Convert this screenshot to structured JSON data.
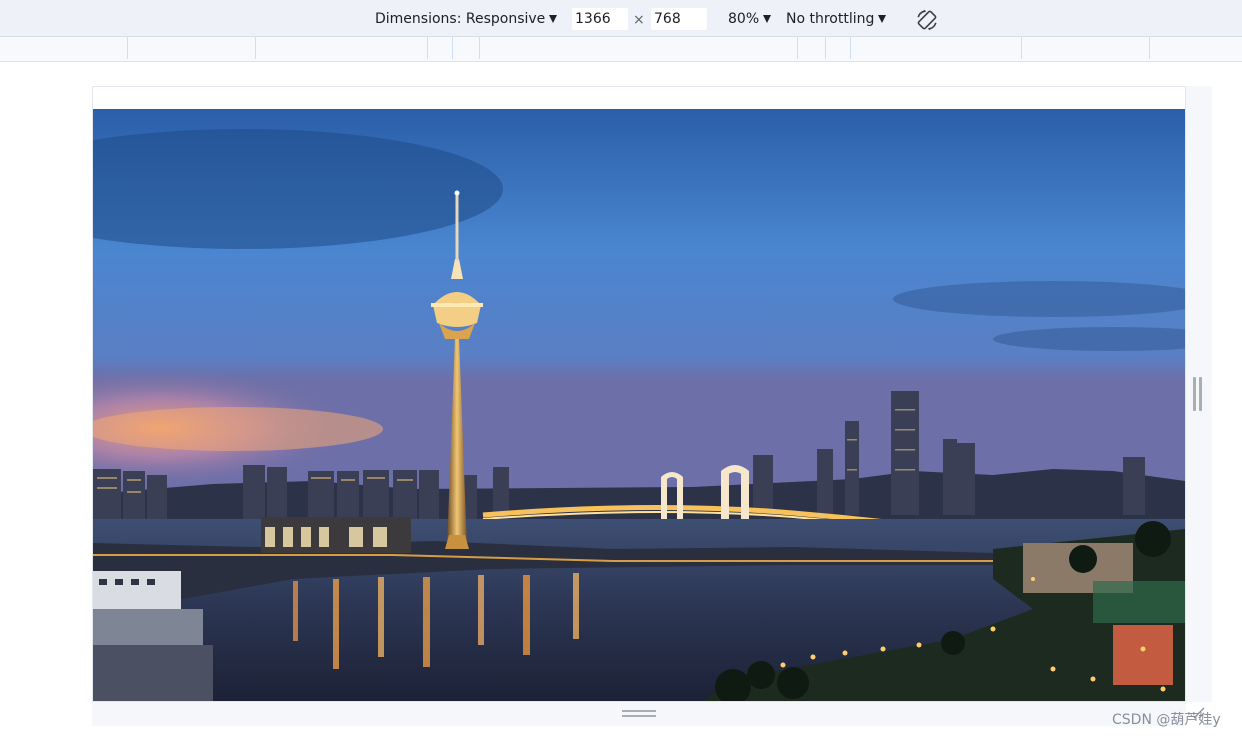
{
  "toolbar": {
    "dimensions_label": "Dimensions: Responsive",
    "width_value": "1366",
    "times_symbol": "×",
    "height_value": "768",
    "zoom_label": "80%",
    "throttling_label": "No throttling",
    "dropdown_icon": "triangle-down-icon",
    "rotate_icon": "rotate-icon"
  },
  "viewport": {
    "image_alt": "Macau Tower and bridges at dusk"
  },
  "watermark": "CSDN @葫芦娃y",
  "colors": {
    "toolbar_bg": "#eef1f7",
    "ruler_bg": "#f8f9fd",
    "ruler_tick": "#cfe0f5",
    "gutter_bg": "#f5f7fb"
  }
}
